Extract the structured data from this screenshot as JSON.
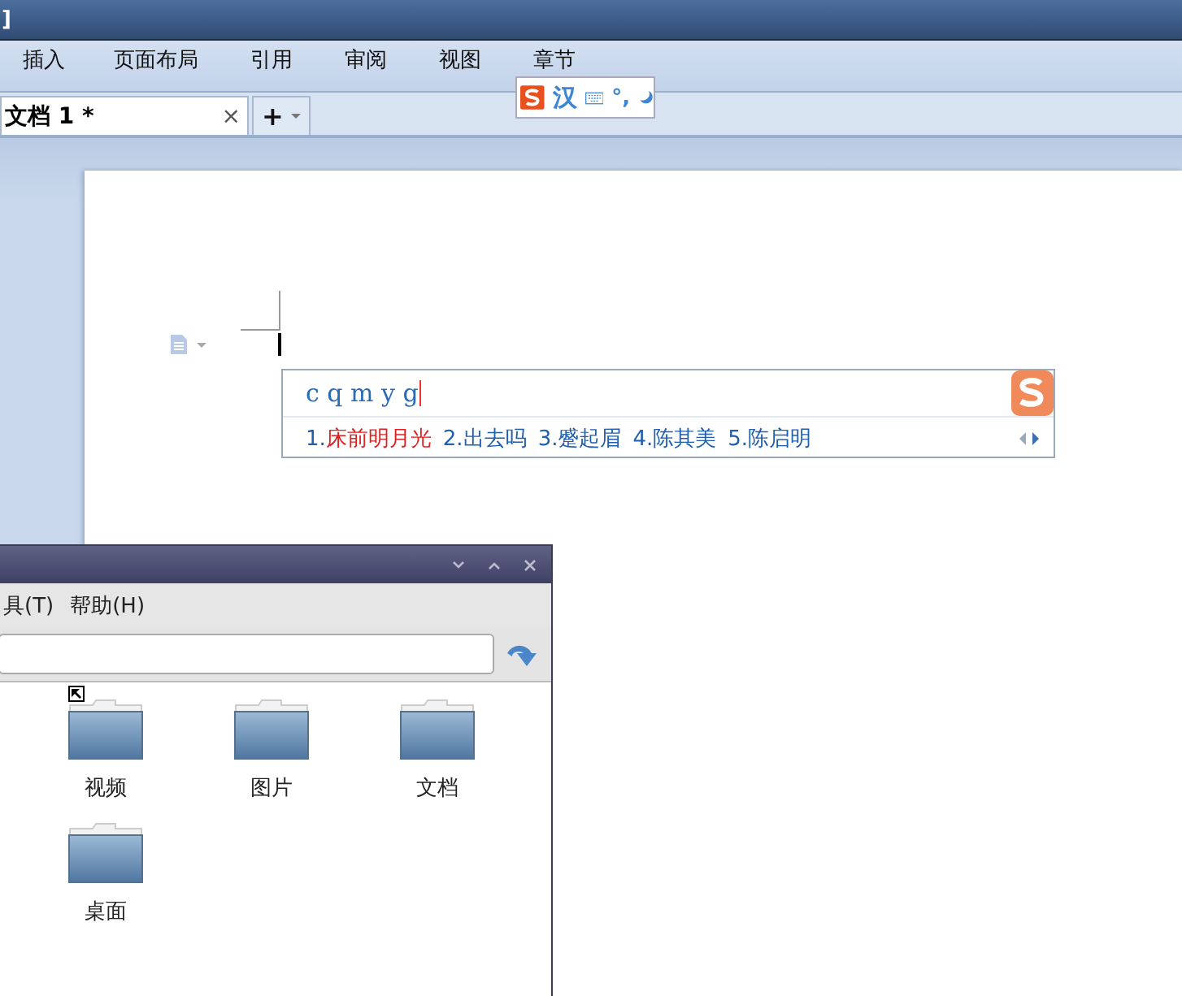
{
  "window": {
    "title": "]"
  },
  "menu": [
    "插入",
    "页面布局",
    "引用",
    "审阅",
    "视图",
    "章节"
  ],
  "tabs": [
    {
      "label": "文档 1 *",
      "selected": true,
      "close": "×"
    },
    {
      "label": "+",
      "selected": false,
      "kind": "new"
    }
  ],
  "ime_toolbar": {
    "mode": "汉",
    "punct": "°,"
  },
  "ime_popup": {
    "input": "c q m y g",
    "candidates": [
      {
        "index": "1.",
        "text": "床前明月光",
        "selected": true
      },
      {
        "index": "2.",
        "text": "出去吗",
        "selected": false
      },
      {
        "index": "3.",
        "text": "蹙起眉",
        "selected": false
      },
      {
        "index": "4.",
        "text": "陈其美",
        "selected": false
      },
      {
        "index": "5.",
        "text": "陈启明",
        "selected": false
      }
    ]
  },
  "file_manager": {
    "menu": [
      "具(T)",
      "帮助(H)"
    ],
    "items": [
      {
        "name": "视频",
        "shortcut": true
      },
      {
        "name": "图片",
        "shortcut": false
      },
      {
        "name": "文档",
        "shortcut": false
      },
      {
        "name": "桌面",
        "shortcut": false
      }
    ]
  }
}
